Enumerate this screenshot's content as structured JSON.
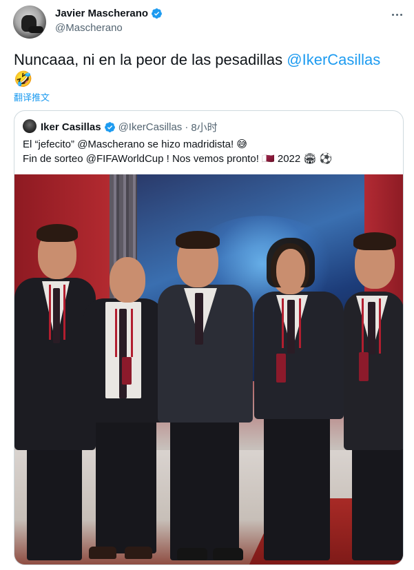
{
  "tweet": {
    "author": {
      "display_name": "Javier Mascherano",
      "handle": "@Mascherano",
      "verified": true,
      "avatar_icon": "profile-photo"
    },
    "text_plain": "Nuncaaa, ni en la peor de las pesadillas ",
    "text_mention": "@IkerCasillas",
    "emoji": "🤣",
    "translate_label": "翻译推文",
    "more_icon": "more-horizontal-icon"
  },
  "quote": {
    "author": {
      "display_name": "Iker Casillas",
      "handle": "@IkerCasillas",
      "separator": "·",
      "time": "8小时",
      "verified": true
    },
    "line1": "El “jefecito” @Mascherano se hizo madridista! 😅",
    "line2": "Fin de sorteo @FIFAWorldCup ! Nos vemos pronto! 🇶🇦 2022 🏟 ⚽",
    "photo_icon": "group-photo-image"
  },
  "colors": {
    "accent": "#1d9bf0",
    "text": "#0f1419",
    "secondary_text": "#536471",
    "border": "#cfd9de"
  }
}
